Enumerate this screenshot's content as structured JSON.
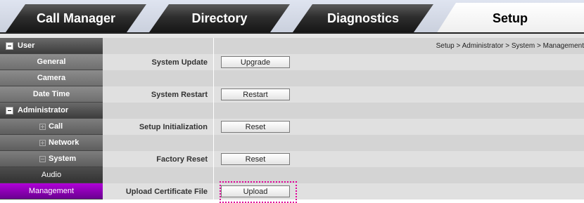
{
  "tabs": [
    {
      "label": "Call Manager"
    },
    {
      "label": "Directory"
    },
    {
      "label": "Diagnostics"
    },
    {
      "label": "Setup"
    }
  ],
  "sidebar": {
    "user": "User",
    "general": "General",
    "camera": "Camera",
    "date_time": "Date Time",
    "administrator": "Administrator",
    "call": "Call",
    "network": "Network",
    "system": "System",
    "audio": "Audio",
    "management": "Management"
  },
  "breadcrumb": "Setup > Administrator > System > Management",
  "rows": {
    "system_update": {
      "label": "System Update",
      "button": "Upgrade"
    },
    "system_restart": {
      "label": "System Restart",
      "button": "Restart"
    },
    "setup_init": {
      "label": "Setup Initialization",
      "button": "Reset"
    },
    "factory_reset": {
      "label": "Factory Reset",
      "button": "Reset"
    },
    "upload_cert": {
      "label": "Upload Certificate File",
      "button": "Upload"
    }
  }
}
